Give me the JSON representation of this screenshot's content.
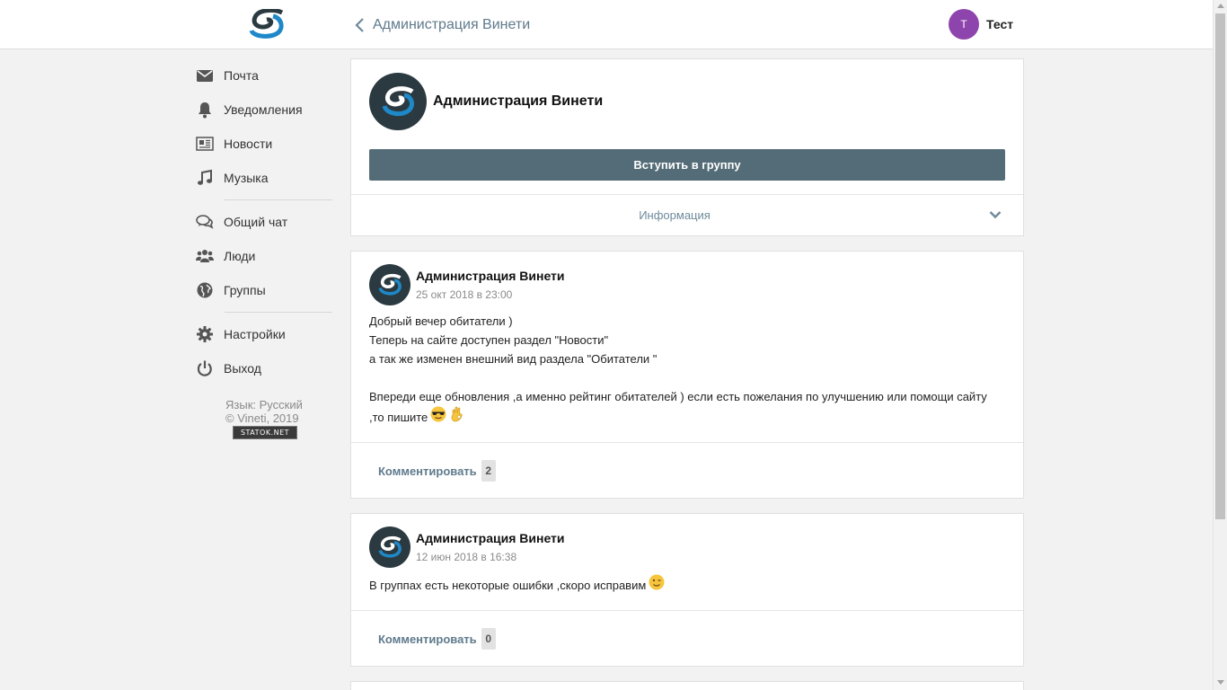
{
  "header": {
    "back_label": "Администрация Винети",
    "user": {
      "initial": "Т",
      "name": "Тест",
      "avatar_color": "#8e44ad"
    }
  },
  "sidebar": {
    "items": [
      {
        "label": "Почта",
        "icon": "envelope-icon"
      },
      {
        "label": "Уведомления",
        "icon": "bell-icon"
      },
      {
        "label": "Новости",
        "icon": "newspaper-icon"
      },
      {
        "label": "Музыка",
        "icon": "music-note-icon"
      },
      {
        "label": "Общий чат",
        "icon": "chat-bubbles-icon"
      },
      {
        "label": "Люди",
        "icon": "people-icon"
      },
      {
        "label": "Группы",
        "icon": "globe-icon"
      },
      {
        "label": "Настройки",
        "icon": "gear-icon"
      },
      {
        "label": "Выход",
        "icon": "power-icon"
      }
    ],
    "footer": {
      "language": "Язык: Русский",
      "copyright": "© Vineti, 2019",
      "counter_badge": "STATOK.NET"
    }
  },
  "group": {
    "name": "Администрация Винети",
    "join_label": "Вступить в группу",
    "info_label": "Информация"
  },
  "posts": [
    {
      "author": "Администрация Винети",
      "date": "25 окт 2018 в 23:00",
      "lines": [
        "Добрый вечер обитатели )",
        "Теперь на сайте доступен раздел \"Новости\"",
        "а так же изменен внешний вид раздела \"Обитатели \"",
        "",
        "Впереди еще обновления ,а именно рейтинг обитателей ) если есть пожелания по улучшению или помощи сайту",
        ",то пишите"
      ],
      "emojis": [
        "sunglasses-emoji",
        "ok-hand-emoji"
      ],
      "comment_label": "Комментировать",
      "comment_count": "2"
    },
    {
      "author": "Администрация Винети",
      "date": "12 июн 2018 в 16:38",
      "lines": [
        "В группах есть некоторые ошибки ,скоро исправим"
      ],
      "emojis": [
        "wink-emoji"
      ],
      "comment_label": "Комментировать",
      "comment_count": "0"
    }
  ],
  "colors": {
    "accent_link": "#5f7a8c",
    "join_button": "#546c77",
    "logo_dark": "#2b3a40",
    "logo_blue": "#1e88c8"
  }
}
